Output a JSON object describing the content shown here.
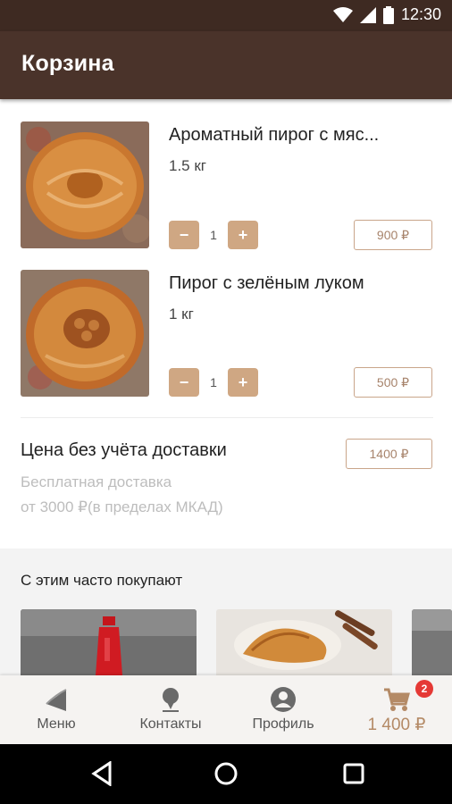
{
  "status_bar": {
    "time": "12:30",
    "icons": [
      "wifi-icon",
      "signal-icon",
      "battery-icon"
    ]
  },
  "app_bar": {
    "title": "Корзина"
  },
  "cart_items": [
    {
      "name": "Ароматный пирог с мяс...",
      "weight": "1.5 кг",
      "quantity": "1",
      "price": "900 ₽",
      "minus": "−",
      "plus": "+"
    },
    {
      "name": "Пирог с зелёным луком",
      "weight": "1 кг",
      "quantity": "1",
      "price": "500 ₽",
      "minus": "−",
      "plus": "+"
    }
  ],
  "summary": {
    "label": "Цена без учёта доставки",
    "total": "1400 ₽",
    "delivery_line1": "Бесплатная доставка",
    "delivery_line2": "от 3000 ₽(в пределах МКАД)"
  },
  "upsell": {
    "title": "С этим часто покупают"
  },
  "bottom_nav": {
    "menu": "Меню",
    "contacts": "Контакты",
    "profile": "Профиль",
    "cart_total": "1 400 ₽",
    "cart_badge": "2"
  },
  "colors": {
    "app_bar": "#4a332a",
    "accent": "#cfa783",
    "price_text": "#a7836b",
    "badge": "#e53935"
  }
}
